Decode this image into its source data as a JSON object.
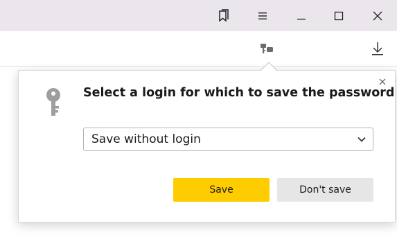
{
  "window": {
    "controls": [
      {
        "name": "bookmarks-icon"
      },
      {
        "name": "menu-icon"
      },
      {
        "name": "minimize-icon"
      },
      {
        "name": "maximize-icon"
      },
      {
        "name": "close-icon"
      }
    ]
  },
  "toolbar": {
    "password_icon": "password-key-icon",
    "download_icon": "download-icon"
  },
  "popup": {
    "title": "Select a login for which to save the password",
    "select_value": "Save without login",
    "save_label": "Save",
    "dont_save_label": "Don't save",
    "accent_color": "#ffcc00"
  }
}
